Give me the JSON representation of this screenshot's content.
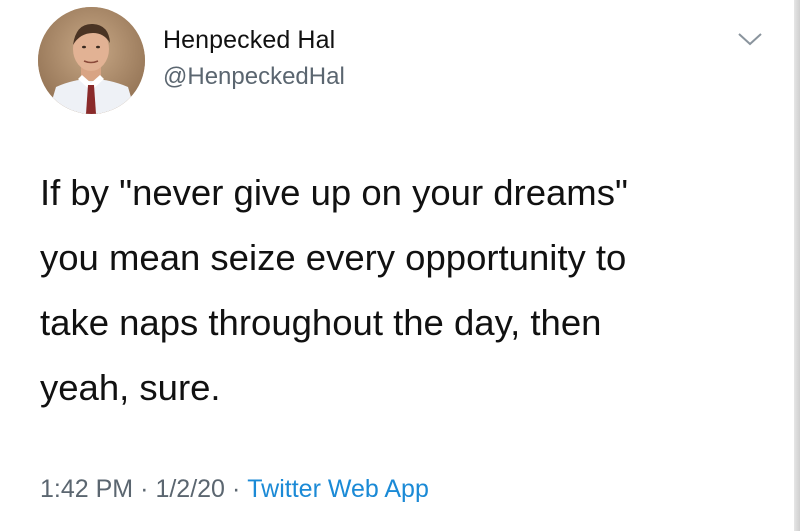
{
  "author": {
    "display_name": "Henpecked Hal",
    "handle": "@HenpeckedHal",
    "avatar_icon": "profile-photo-icon"
  },
  "menu": {
    "icon": "chevron-down-icon"
  },
  "tweet": {
    "lines": [
      "If by \"never give up on your dreams\"",
      "you mean seize every opportunity to",
      "take naps throughout the day, then",
      "yeah, sure."
    ]
  },
  "meta": {
    "time": "1:42 PM",
    "separator": "·",
    "date": "1/2/20",
    "source": "Twitter Web App"
  },
  "colors": {
    "text": "#111111",
    "secondary": "#5b6670",
    "link": "#1b8ad6",
    "background": "#ffffff"
  }
}
